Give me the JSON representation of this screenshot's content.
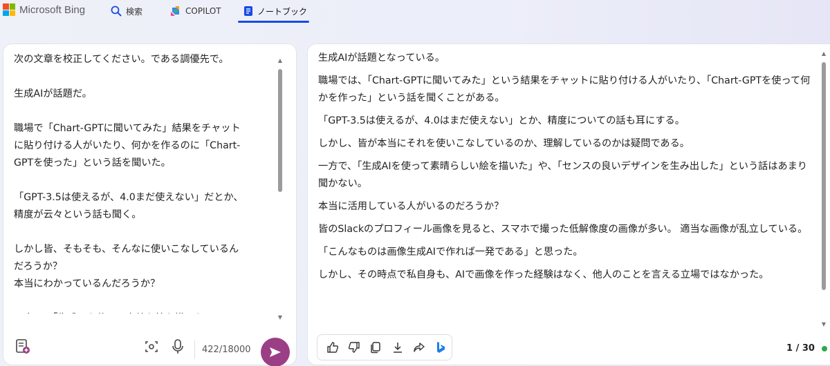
{
  "header": {
    "brand": "Microsoft Bing",
    "nav": [
      {
        "label": "検索",
        "icon": "search-icon"
      },
      {
        "label": "COPILOT",
        "icon": "copilot-icon"
      },
      {
        "label": "ノートブック",
        "icon": "notebook-icon"
      }
    ],
    "active_tab": "ノートブック"
  },
  "left_panel": {
    "lines": [
      "次の文章を校正してください。である調優先で。",
      "",
      "生成AIが話題だ。",
      "",
      "職場で「Chart-GPTに聞いてみた」結果をチャット",
      "に貼り付ける人がいたり、何かを作るのに「Chart-",
      "GPTを使った」という話を聞いた。",
      "",
      "「GPT-3.5は使えるが、4.0まだ使えない」だとか、",
      "精度が云々という話も聞く。",
      "",
      "しかし皆、そもそも、そんなに使いこなしているん",
      "だろうか？",
      "本当にわかっているんだろうか？",
      "",
      "一方で、「生成AIを使って素敵な絵を描いた。」と"
    ],
    "char_count": "422/18000",
    "icons": [
      "new-note-icon",
      "screenshot-icon",
      "mic-icon",
      "send-icon"
    ]
  },
  "right_panel": {
    "paragraphs": [
      "生成AIが話題となっている。",
      "職場では、「Chart-GPTに聞いてみた」という結果をチャットに貼り付ける人がいたり、「Chart-GPTを使って何かを作った」という話を聞くことがある。",
      "「GPT-3.5は使えるが、4.0はまだ使えない」とか、精度についての話も耳にする。",
      "しかし、皆が本当にそれを使いこなしているのか、理解しているのかは疑問である。",
      "一方で、「生成AIを使って素晴らしい絵を描いた」や、「センスの良いデザインを生み出した」という話はあまり聞かない。",
      "本当に活用している人がいるのだろうか？",
      "皆のSlackのプロフィール画像を見ると、スマホで撮った低解像度の画像が多い。 適当な画像が乱立している。",
      "「こんなものは画像生成AIで作れば一発である」と思った。",
      "しかし、その時点で私自身も、AIで画像を作った経験はなく、他人のことを言える立場ではなかった。"
    ],
    "toolbar": [
      "thumbs-up-icon",
      "thumbs-down-icon",
      "copy-icon",
      "download-icon",
      "share-icon",
      "bing-icon"
    ],
    "page_indicator": "1 / 30",
    "status_color": "#2fa84f"
  },
  "colors": {
    "accent": "#174ae4",
    "send": "#9a3f85"
  }
}
